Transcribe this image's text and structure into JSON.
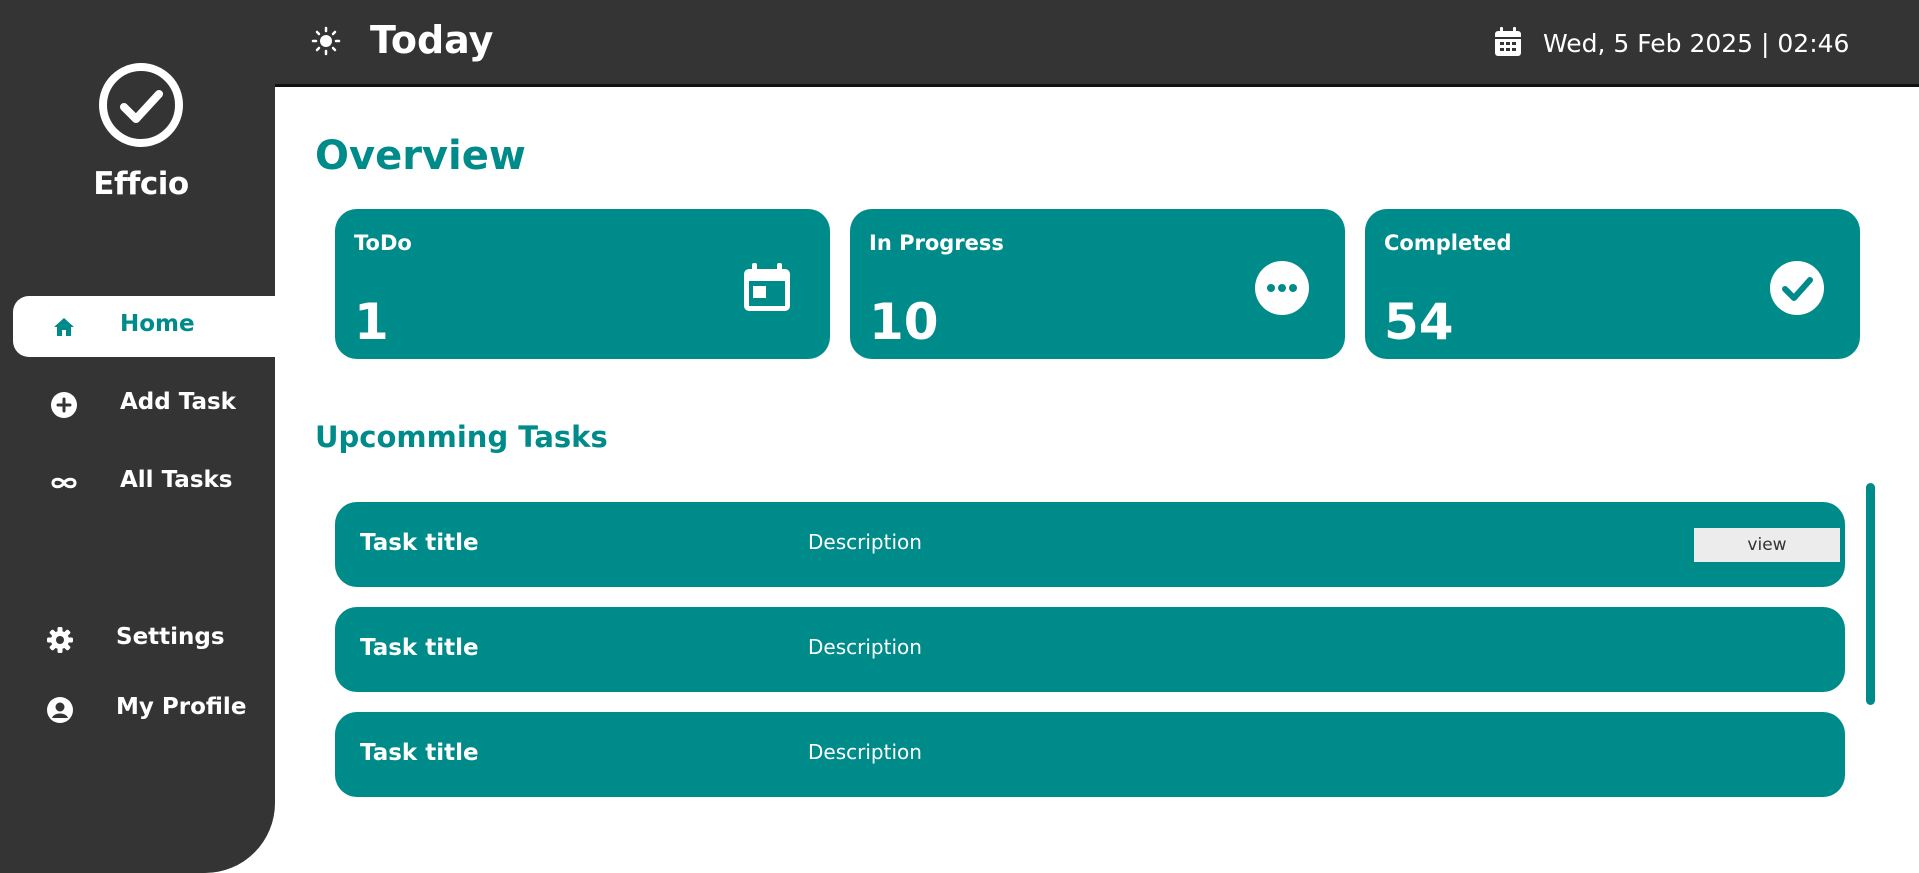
{
  "sidebar": {
    "brand": "Effcio",
    "nav": [
      {
        "label": "Home",
        "icon": "home-icon",
        "active": true
      },
      {
        "label": "Add Task",
        "icon": "plus-circle-icon",
        "active": false
      },
      {
        "label": "All Tasks",
        "icon": "infinity-icon",
        "active": false
      }
    ],
    "bottom_nav": [
      {
        "label": "Settings",
        "icon": "gear-icon"
      },
      {
        "label": "My Profile",
        "icon": "user-circle-icon"
      }
    ]
  },
  "header": {
    "title": "Today",
    "datetime": "Wed, 5 Feb 2025  |  02:46"
  },
  "main": {
    "overview_title": "Overview",
    "stats": [
      {
        "label": "ToDo",
        "value": "1",
        "icon": "calendar-icon"
      },
      {
        "label": "In Progress",
        "value": "10",
        "icon": "ellipsis-circle-icon"
      },
      {
        "label": "Completed",
        "value": "54",
        "icon": "check-circle-icon"
      }
    ],
    "upcoming_title": "Upcomming Tasks",
    "tasks": [
      {
        "title": "Task title",
        "description": "Description",
        "button": "view"
      },
      {
        "title": "Task title",
        "description": "Description"
      },
      {
        "title": "Task title",
        "description": "Description"
      }
    ]
  },
  "colors": {
    "accent": "#008b8b",
    "dark": "#343434",
    "surface": "#ffffff"
  }
}
